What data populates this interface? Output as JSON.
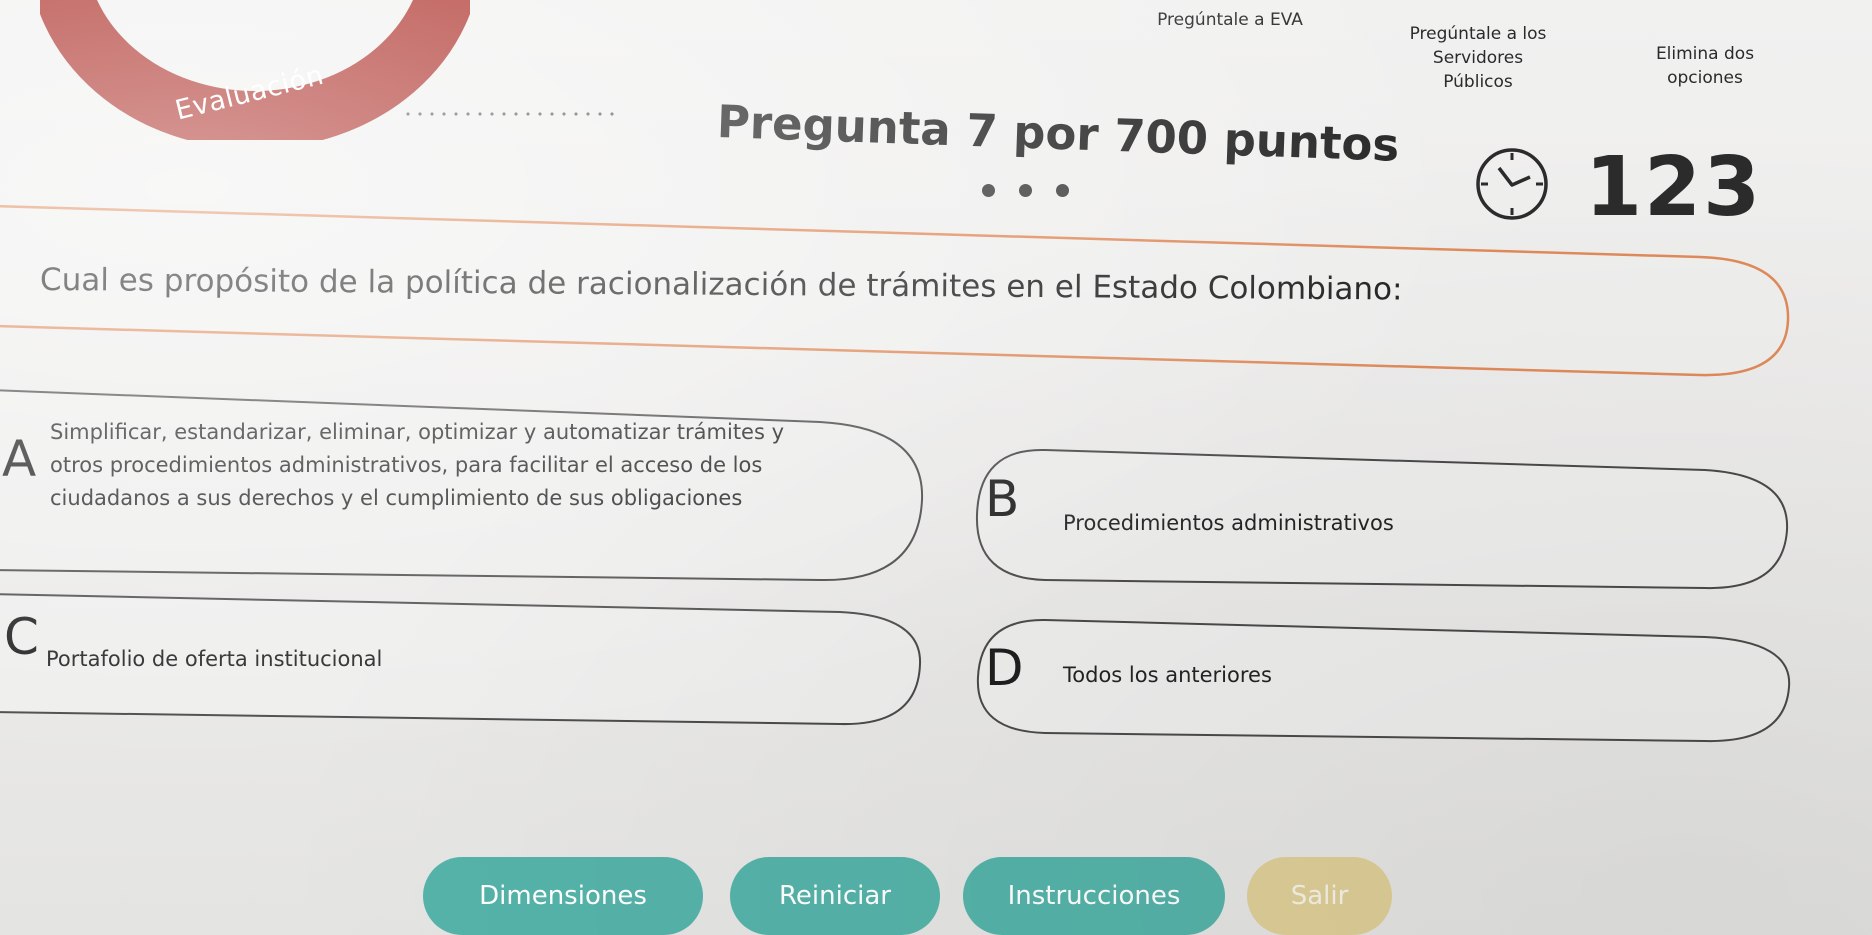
{
  "header": {
    "badge_label": "Evaluación",
    "question_title": "Pregunta 7 por 700 puntos"
  },
  "lifelines": {
    "eva": "Pregúntale a EVA",
    "servidores": [
      "Pregúntale a los",
      "Servidores",
      "Públicos"
    ],
    "opciones": [
      "Elimina dos",
      "opciones"
    ]
  },
  "timer": {
    "icon": "clock-icon",
    "value": "123"
  },
  "question": {
    "text": "Cual es propósito de la política de racionalización de trámites en el Estado Colombiano:"
  },
  "options": [
    {
      "letter": "A",
      "lines": [
        "Simplificar, estandarizar, eliminar, optimizar y automatizar trámites y",
        "otros procedimientos administrativos, para facilitar el acceso de los",
        "ciudadanos a sus derechos y el cumplimiento de sus obligaciones"
      ]
    },
    {
      "letter": "B",
      "lines": [
        "Procedimientos administrativos"
      ]
    },
    {
      "letter": "C",
      "lines": [
        "Portafolio de oferta institucional"
      ]
    },
    {
      "letter": "D",
      "lines": [
        "Todos los anteriores"
      ]
    }
  ],
  "buttons": {
    "dimensiones": "Dimensiones",
    "reiniciar": "Reiniciar",
    "instrucciones": "Instrucciones",
    "salir": "Salir"
  },
  "colors": {
    "badge_red": "#a8231c",
    "banner_orange": "#e08a5a",
    "button_teal": "#55b3a9",
    "button_gold": "#dfcf98"
  }
}
